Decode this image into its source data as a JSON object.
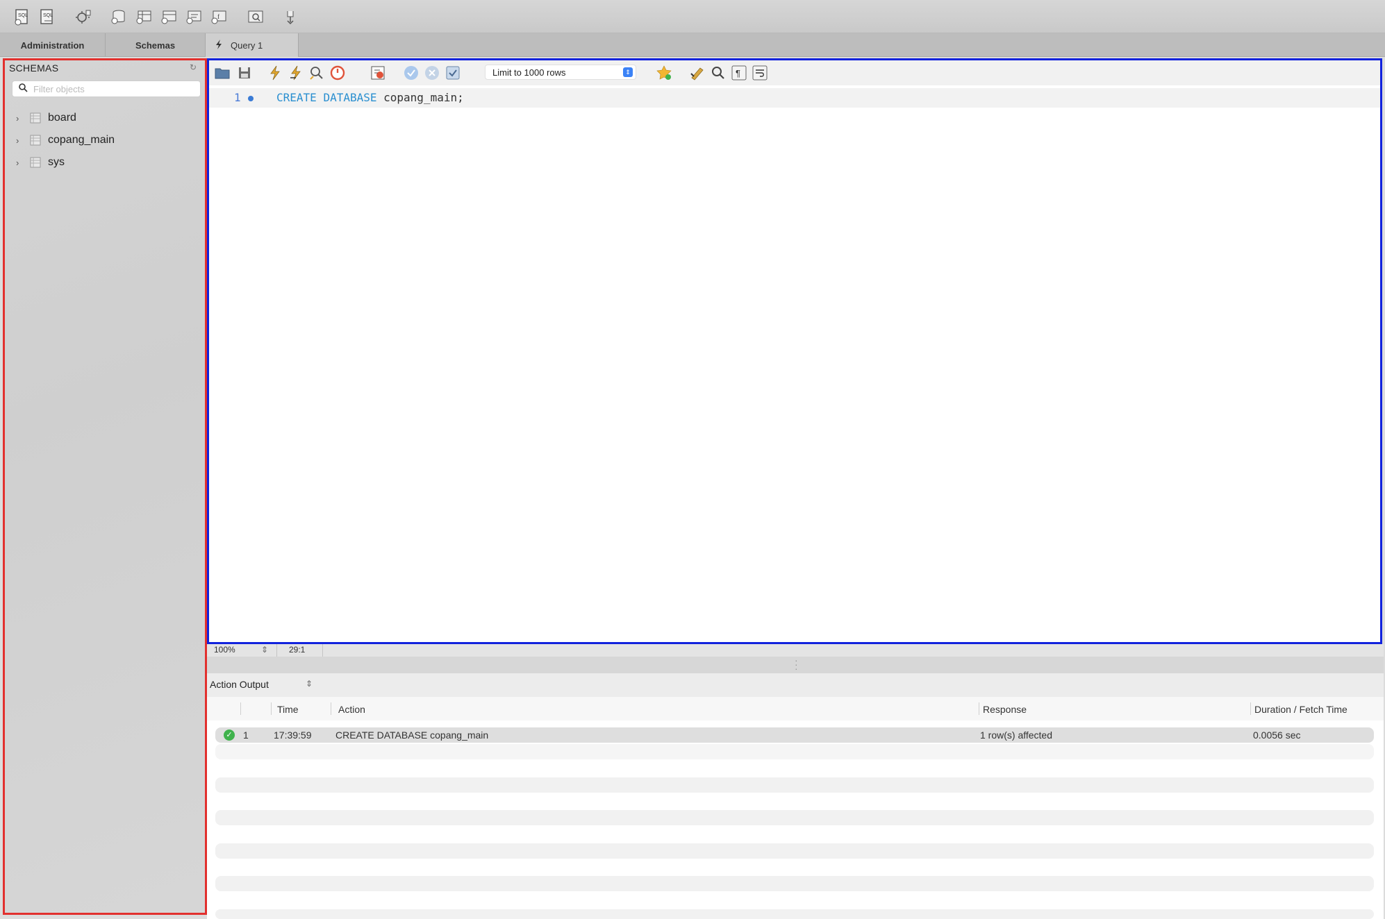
{
  "tabs": {
    "administration": "Administration",
    "schemas": "Schemas",
    "query": "Query 1"
  },
  "sidebar": {
    "title": "SCHEMAS",
    "filter_placeholder": "Filter objects",
    "schemas": [
      "board",
      "copang_main",
      "sys"
    ]
  },
  "editor": {
    "limit_rows": "Limit to 1000 rows",
    "line_number": "1",
    "code": {
      "kw1": "CREATE",
      "kw2": "DATABASE",
      "ident": "copang_main;"
    }
  },
  "status": {
    "zoom": "100%",
    "cursor": "29:1"
  },
  "output": {
    "selector": "Action Output",
    "columns": {
      "time": "Time",
      "action": "Action",
      "response": "Response",
      "duration": "Duration / Fetch Time"
    },
    "rows": [
      {
        "num": "1",
        "time": "17:39:59",
        "action": "CREATE DATABASE copang_main",
        "response": "1 row(s) affected",
        "duration": "0.0056 sec"
      }
    ]
  },
  "colors": {
    "sidebar_border": "#e2302e",
    "editor_border": "#1122dd",
    "keyword": "#2a8fd0",
    "success": "#3fb24c"
  }
}
